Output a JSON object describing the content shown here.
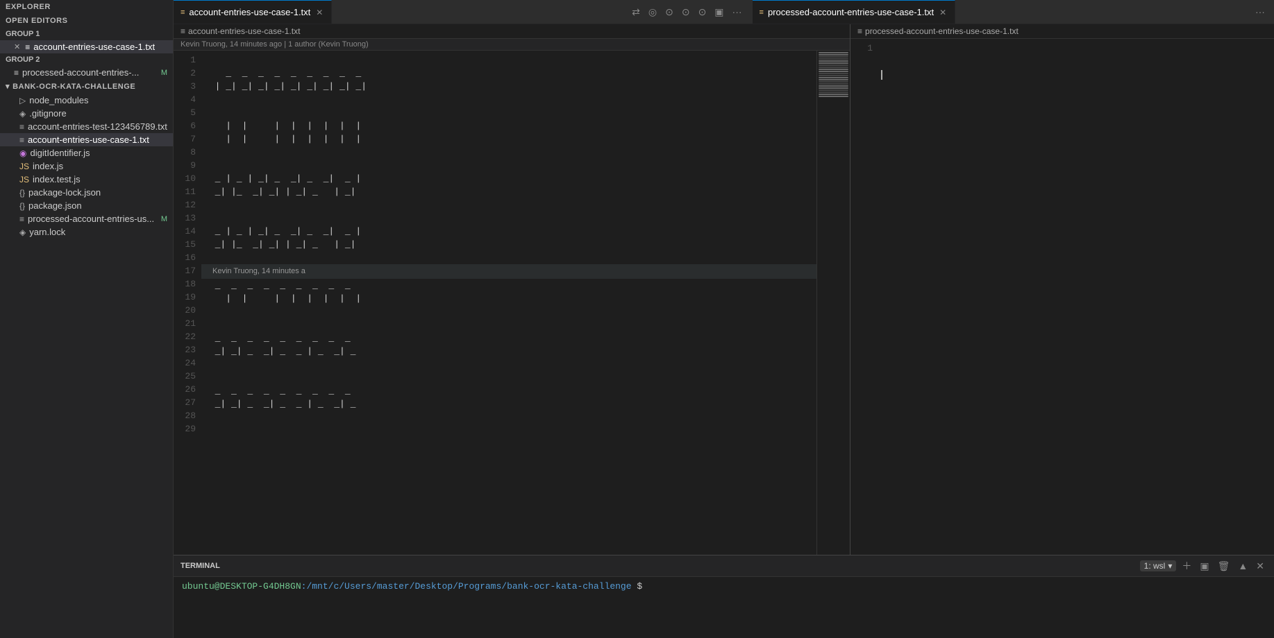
{
  "sidebar": {
    "explorer_label": "EXPLORER",
    "open_editors_label": "OPEN EDITORS",
    "group1_label": "GROUP 1",
    "group1_files": [
      {
        "name": "account-entries-use-case-1.txt",
        "icon": "≡",
        "active": true,
        "hasClose": true
      }
    ],
    "group2_label": "GROUP 2",
    "group2_files": [
      {
        "name": "processed-account-entries-...",
        "icon": "≡",
        "badge": "M"
      }
    ],
    "project_label": "BANK-OCR-KATA-CHALLENGE",
    "tree_items": [
      {
        "name": "node_modules",
        "icon": "▷",
        "indent": 1
      },
      {
        "name": ".gitignore",
        "icon": "◈",
        "indent": 1
      },
      {
        "name": "account-entries-test-123456789.txt",
        "icon": "≡",
        "indent": 1
      },
      {
        "name": "account-entries-use-case-1.txt",
        "icon": "≡",
        "indent": 1,
        "active": true
      },
      {
        "name": "digitIdentifier.js",
        "icon": "◉",
        "indent": 1
      },
      {
        "name": "index.js",
        "icon": "JS",
        "indent": 1
      },
      {
        "name": "index.test.js",
        "icon": "JS",
        "indent": 1
      },
      {
        "name": "package-lock.json",
        "icon": "{}",
        "indent": 1
      },
      {
        "name": "package.json",
        "icon": "{}",
        "indent": 1
      },
      {
        "name": "processed-account-entries-us...",
        "icon": "≡",
        "indent": 1,
        "badge": "M"
      },
      {
        "name": "yarn.lock",
        "icon": "◈",
        "indent": 1
      }
    ]
  },
  "left_tab": {
    "filename": "account-entries-use-case-1.txt",
    "icon": "≡"
  },
  "left_breadcrumb": "account-entries-use-case-1.txt",
  "blame_info": "Kevin Truong, 14 minutes ago | 1 author (Kevin Truong)",
  "toolbar_icons": [
    "⇄",
    "◎",
    "⊙",
    "⊙",
    "⊙",
    "▣",
    "···"
  ],
  "left_lines": [
    1,
    2,
    3,
    4,
    5,
    6,
    7,
    8,
    9,
    10,
    11,
    12,
    13,
    14,
    15,
    16,
    17,
    18,
    19,
    20,
    21,
    22,
    23,
    24,
    25,
    26,
    27,
    28,
    29
  ],
  "line_codes": {
    "2": "    _  _  _  _  _  _  _  _  _ ",
    "3": "  | _| _| _| _| _| _| _| _| _|",
    "4": "",
    "5": "",
    "6": "    |  |     |  |  |  |  |  | ",
    "7": "    |  |     |  |  |  |  |  | ",
    "8": "",
    "9": "",
    "10": "  _ | _ | _| _  _| _  _|  _ |",
    "11": "  _| |_  _| _| | _| _   | _| ",
    "12": "",
    "13": "",
    "14": "  _ | _ | _| _  _| _  _|  _ |",
    "15": "  _| |_  _| _| | _| _   | _| ",
    "16": "",
    "17": "",
    "18": "  _  _  _  _  _  _  _  _  _  ",
    "19": "    |  |     |  |  |  |  |  | ",
    "20": "",
    "21": "",
    "22": "  _  _  _  _  _  _  _  _  _  ",
    "23": "  _| _| _  _| _  _ | _  _| _ ",
    "24": "",
    "25": "",
    "26": "  _  _  _  _  _  _  _  _  _  ",
    "27": "  _| _| _  _| _  _ | _  _| _ "
  },
  "right_tab": {
    "filename": "processed-account-entries-use-case-1.txt",
    "icon": "≡"
  },
  "right_lines": [
    1
  ],
  "right_code": {
    "1": ""
  },
  "terminal": {
    "title": "TERMINAL",
    "wsl_label": "1: wsl",
    "prompt_user": "ubuntu@DESKTOP-G4DH8GN",
    "prompt_path": ":/mnt/c/Users/master/Desktop/Programs/bank-ocr-kata-challenge",
    "prompt_suffix": "$"
  },
  "colors": {
    "active_tab_border": "#007acc",
    "sidebar_bg": "#252526",
    "editor_bg": "#1e1e1e",
    "terminal_green": "#73c991",
    "terminal_blue": "#569cd6"
  }
}
